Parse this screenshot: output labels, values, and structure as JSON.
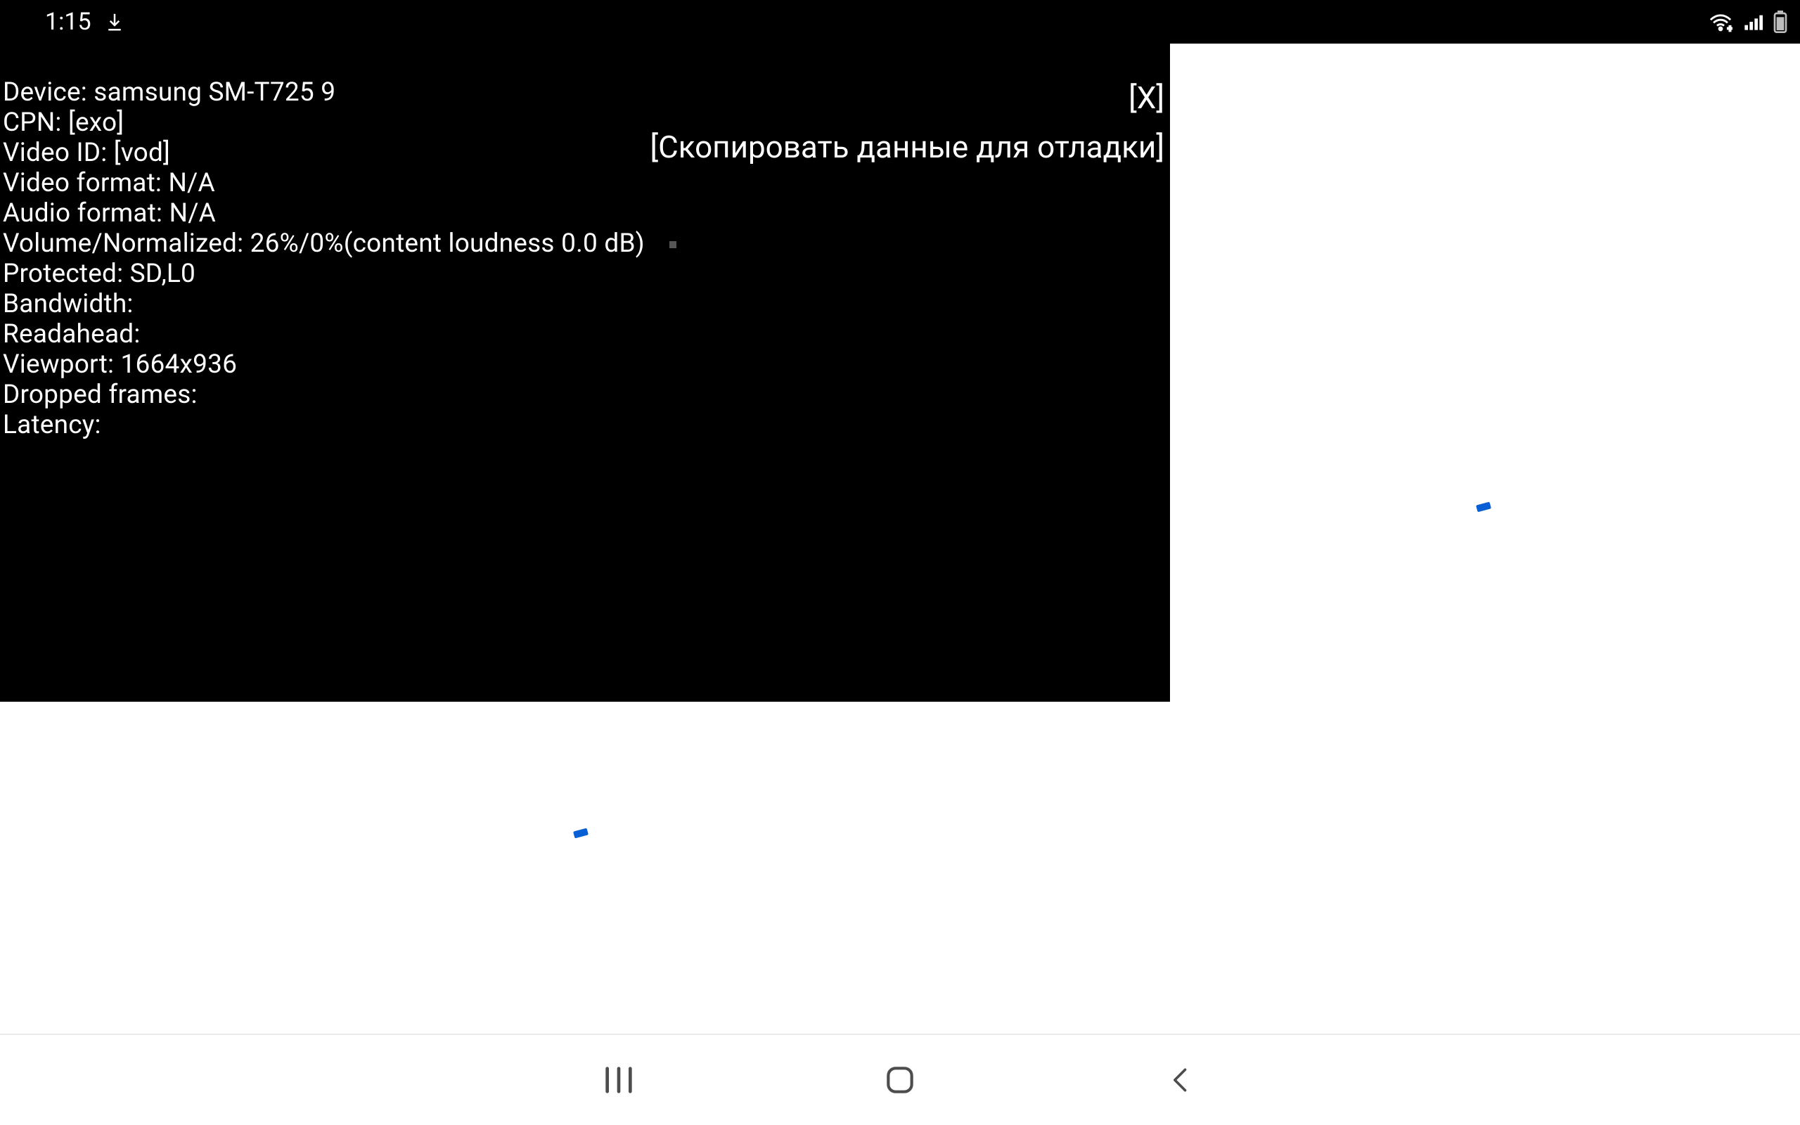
{
  "status_bar": {
    "time": "1:15",
    "icons": {
      "download": "download-icon",
      "wifi": "wifi-icon",
      "signal": "signal-icon",
      "battery": "battery-icon"
    }
  },
  "debug": {
    "device_label": "Device: samsung SM-T725 9",
    "cpn_label": "CPN:  [exo]",
    "video_id_label": "Video ID:  [vod]",
    "video_format_label": "Video format: N/A",
    "audio_format_label": "Audio format: N/A",
    "volume_label": "Volume/Normalized: 26%/0%(content loudness 0.0 dB)",
    "protected_label": "Protected: SD,L0",
    "bandwidth_label": "Bandwidth:",
    "readahead_label": "Readahead:",
    "viewport_label": "Viewport: 1664x936",
    "dropped_frames_label": "Dropped frames:",
    "latency_label": "Latency:"
  },
  "overlay_actions": {
    "close": "[X]",
    "copy": "[Скопировать данные для отладки]"
  }
}
